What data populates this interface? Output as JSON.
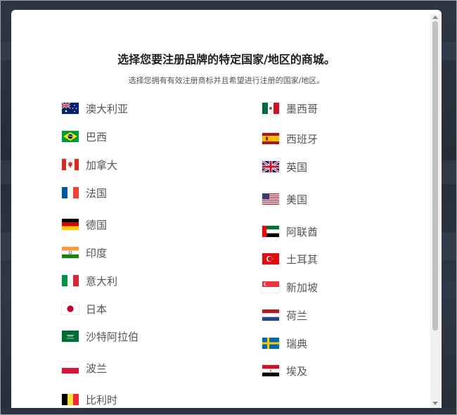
{
  "modal": {
    "title": "选择您要注册品牌的特定国家/地区的商城。",
    "subtitle": "选择您拥有有效注册商标并且希望进行注册的国家/地区。"
  },
  "countries_left": [
    {
      "name": "澳大利亚",
      "flag": "australia"
    },
    {
      "name": "巴西",
      "flag": "brazil"
    },
    {
      "name": "加拿大",
      "flag": "canada"
    },
    {
      "name": "法国",
      "flag": "france"
    },
    {
      "name": "德国",
      "flag": "germany"
    },
    {
      "name": "印度",
      "flag": "india"
    },
    {
      "name": "意大利",
      "flag": "italy"
    },
    {
      "name": "日本",
      "flag": "japan"
    },
    {
      "name": "沙特阿拉伯",
      "flag": "saudi-arabia"
    },
    {
      "name": "波兰",
      "flag": "poland"
    },
    {
      "name": "比利时",
      "flag": "belgium"
    }
  ],
  "countries_right": [
    {
      "name": "墨西哥",
      "flag": "mexico"
    },
    {
      "name": "西班牙",
      "flag": "spain"
    },
    {
      "name": "英国",
      "flag": "united-kingdom"
    },
    {
      "name": "美国",
      "flag": "united-states"
    },
    {
      "name": "阿联酋",
      "flag": "uae"
    },
    {
      "name": "土耳其",
      "flag": "turkey"
    },
    {
      "name": "新加坡",
      "flag": "singapore"
    },
    {
      "name": "荷兰",
      "flag": "netherlands"
    },
    {
      "name": "瑞典",
      "flag": "sweden"
    },
    {
      "name": "埃及",
      "flag": "egypt"
    }
  ],
  "colors": {
    "modal_background": "#ffffff",
    "title_text": "#1f1f1f",
    "country_text": "#555555",
    "backdrop": "#2b3340"
  }
}
